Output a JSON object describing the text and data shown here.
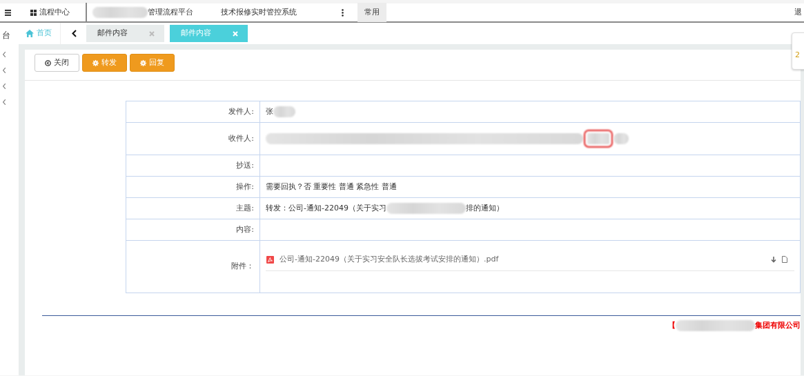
{
  "topbar": {
    "app_title": "流程中心",
    "links": [
      {
        "label": "管理流程平台",
        "redacted_before": true
      },
      {
        "label": "技术报修实时管控系统",
        "redacted_before": false
      }
    ],
    "common_button": "常用",
    "logout": "退"
  },
  "sidebar": {
    "title_fragment": "台"
  },
  "nav": {
    "home": "首页",
    "tabs": [
      {
        "label": "邮件内容",
        "selected": false
      },
      {
        "label": "邮件内容",
        "selected": true
      }
    ]
  },
  "toolbar": {
    "buttons": [
      {
        "label": "关闭",
        "kind": "close"
      },
      {
        "label": "转发",
        "kind": "action"
      },
      {
        "label": "回复",
        "kind": "action"
      }
    ]
  },
  "fields": [
    {
      "label": "发件人:",
      "segments": [
        {
          "kind": "text",
          "text": "张"
        },
        {
          "kind": "short"
        }
      ]
    },
    {
      "label": "收件人:",
      "segments": [
        {
          "kind": "long"
        },
        {
          "kind": "short",
          "highlighted": true
        },
        {
          "kind": "tiny"
        }
      ]
    },
    {
      "label": "抄送:"
    },
    {
      "label": "操作:",
      "segments": [
        {
          "kind": "text",
          "text": "需要回执？否  重要性  普通   紧急性  普通"
        }
      ]
    },
    {
      "label": "主题:",
      "segments": [
        {
          "kind": "text",
          "text": "转发：公司-通知-22049（关于实习"
        },
        {
          "kind": "medium"
        },
        {
          "kind": "text",
          "text": "排的通知）"
        }
      ]
    },
    {
      "label": "内容:"
    },
    {
      "label": "附件：",
      "attachments": [
        {
          "name": "公司-通知-22049（关于实习安全队长选拔考试安排的通知）.pdf"
        }
      ]
    }
  ],
  "footer": {
    "segments": [
      {
        "kind": "text",
        "text": "【"
      },
      {
        "kind": "medium"
      },
      {
        "kind": "text",
        "text": "集团有限公司"
      }
    ]
  },
  "side_widget": {
    "text": "2"
  }
}
